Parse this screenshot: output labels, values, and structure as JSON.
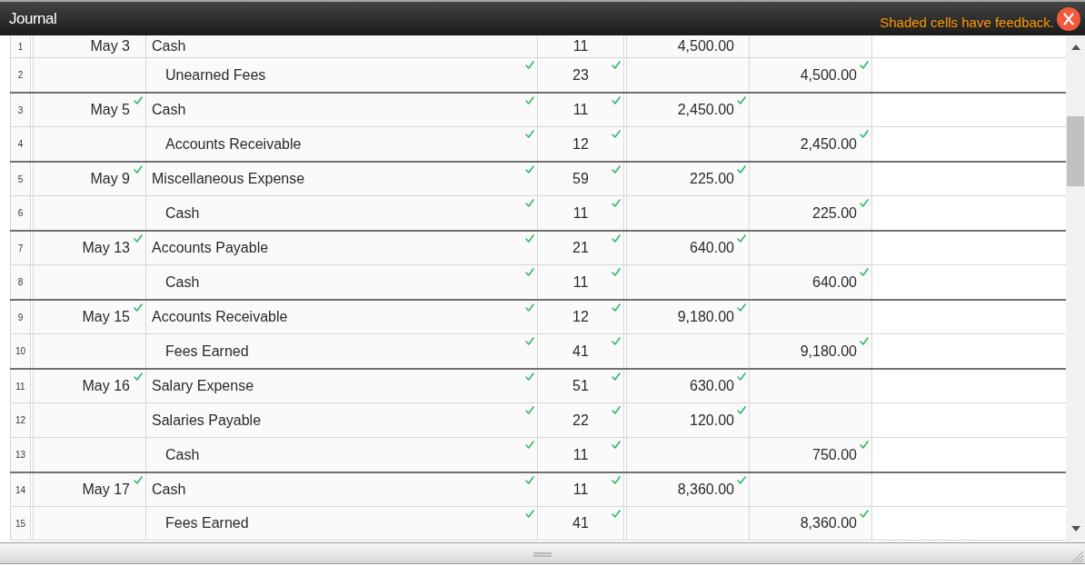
{
  "window": {
    "title": "Journal",
    "notice": "Shaded cells have feedback."
  },
  "journal": {
    "rows": [
      {
        "line": "1",
        "date": {
          "text": "May 3",
          "checked": false
        },
        "account": {
          "text": "Cash",
          "checked": false,
          "indented": false
        },
        "post_ref": {
          "text": "11",
          "checked": false
        },
        "debit": {
          "text": "4,500.00",
          "checked": false
        }
      },
      {
        "line": "2",
        "account": {
          "text": "Unearned Fees",
          "checked": true,
          "indented": true
        },
        "post_ref": {
          "text": "23",
          "checked": true
        },
        "credit": {
          "text": "4,500.00",
          "checked": true
        }
      },
      {
        "line": "3",
        "date": {
          "text": "May 5",
          "checked": true
        },
        "account": {
          "text": "Cash",
          "checked": true,
          "indented": false
        },
        "post_ref": {
          "text": "11",
          "checked": true
        },
        "debit": {
          "text": "2,450.00",
          "checked": true
        }
      },
      {
        "line": "4",
        "account": {
          "text": "Accounts Receivable",
          "checked": true,
          "indented": true
        },
        "post_ref": {
          "text": "12",
          "checked": true
        },
        "credit": {
          "text": "2,450.00",
          "checked": true
        }
      },
      {
        "line": "5",
        "date": {
          "text": "May 9",
          "checked": true
        },
        "account": {
          "text": "Miscellaneous Expense",
          "checked": true,
          "indented": false
        },
        "post_ref": {
          "text": "59",
          "checked": true
        },
        "debit": {
          "text": "225.00",
          "checked": true
        }
      },
      {
        "line": "6",
        "account": {
          "text": "Cash",
          "checked": true,
          "indented": true
        },
        "post_ref": {
          "text": "11",
          "checked": true
        },
        "credit": {
          "text": "225.00",
          "checked": true
        }
      },
      {
        "line": "7",
        "date": {
          "text": "May 13",
          "checked": true
        },
        "account": {
          "text": "Accounts Payable",
          "checked": true,
          "indented": false
        },
        "post_ref": {
          "text": "21",
          "checked": true
        },
        "debit": {
          "text": "640.00",
          "checked": true
        }
      },
      {
        "line": "8",
        "account": {
          "text": "Cash",
          "checked": true,
          "indented": true
        },
        "post_ref": {
          "text": "11",
          "checked": true
        },
        "credit": {
          "text": "640.00",
          "checked": true
        }
      },
      {
        "line": "9",
        "date": {
          "text": "May 15",
          "checked": true
        },
        "account": {
          "text": "Accounts Receivable",
          "checked": true,
          "indented": false
        },
        "post_ref": {
          "text": "12",
          "checked": true
        },
        "debit": {
          "text": "9,180.00",
          "checked": true
        }
      },
      {
        "line": "10",
        "account": {
          "text": "Fees Earned",
          "checked": true,
          "indented": true
        },
        "post_ref": {
          "text": "41",
          "checked": true
        },
        "credit": {
          "text": "9,180.00",
          "checked": true
        }
      },
      {
        "line": "11",
        "date": {
          "text": "May 16",
          "checked": true
        },
        "account": {
          "text": "Salary Expense",
          "checked": true,
          "indented": false
        },
        "post_ref": {
          "text": "51",
          "checked": true
        },
        "debit": {
          "text": "630.00",
          "checked": true
        }
      },
      {
        "line": "12",
        "account": {
          "text": "Salaries Payable",
          "checked": true,
          "indented": false
        },
        "post_ref": {
          "text": "22",
          "checked": true
        },
        "debit": {
          "text": "120.00",
          "checked": true
        }
      },
      {
        "line": "13",
        "account": {
          "text": "Cash",
          "checked": true,
          "indented": true
        },
        "post_ref": {
          "text": "11",
          "checked": true
        },
        "credit": {
          "text": "750.00",
          "checked": true
        }
      },
      {
        "line": "14",
        "date": {
          "text": "May 17",
          "checked": true
        },
        "account": {
          "text": "Cash",
          "checked": true,
          "indented": false
        },
        "post_ref": {
          "text": "11",
          "checked": true
        },
        "debit": {
          "text": "8,360.00",
          "checked": true
        }
      },
      {
        "line": "15",
        "account": {
          "text": "Fees Earned",
          "checked": true,
          "indented": true
        },
        "post_ref": {
          "text": "41",
          "checked": true
        },
        "credit": {
          "text": "8,360.00",
          "checked": true
        }
      }
    ]
  }
}
